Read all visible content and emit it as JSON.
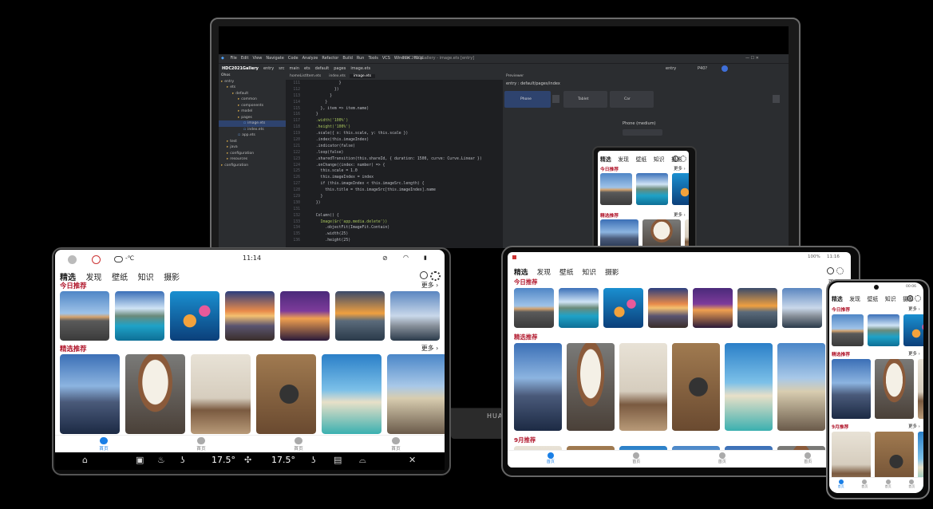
{
  "laptop": {
    "brand": "HUAWEI",
    "ide": {
      "menu": [
        "File",
        "Edit",
        "View",
        "Navigate",
        "Code",
        "Analyze",
        "Refactor",
        "Build",
        "Run",
        "Tools",
        "VCS",
        "Window",
        "Help"
      ],
      "window_title": "HDC2021Gallery - image.ets [entry]",
      "breadcrumb": [
        "HDC2021Gallery",
        "entry",
        "src",
        "main",
        "ets",
        "default",
        "pages",
        "image.ets"
      ],
      "run_config": "entry",
      "device": "P40?",
      "project_label": "Ohos",
      "tree": [
        {
          "label": "entry",
          "indent": 0
        },
        {
          "label": "ets",
          "indent": 1
        },
        {
          "label": "default",
          "indent": 2
        },
        {
          "label": "common",
          "indent": 3
        },
        {
          "label": "components",
          "indent": 3
        },
        {
          "label": "model",
          "indent": 3
        },
        {
          "label": "pages",
          "indent": 3
        },
        {
          "label": "image.ets",
          "indent": 4,
          "selected": true
        },
        {
          "label": "index.ets",
          "indent": 4
        },
        {
          "label": "app.ets",
          "indent": 3
        },
        {
          "label": "test",
          "indent": 1
        },
        {
          "label": "java",
          "indent": 1
        },
        {
          "label": "configuration",
          "indent": 1
        },
        {
          "label": "resources",
          "indent": 1
        },
        {
          "label": "configuration",
          "indent": 0
        }
      ],
      "tabs": [
        "homeListItem.ets",
        "index.ets",
        "image.ets"
      ],
      "active_tab": 2,
      "code": [
        {
          "n": "111",
          "t": "            }"
        },
        {
          "n": "112",
          "t": "          })"
        },
        {
          "n": "113",
          "t": "        }"
        },
        {
          "n": "114",
          "t": "      }"
        },
        {
          "n": "115",
          "t": "    }, item => item.name)"
        },
        {
          "n": "116",
          "t": "  }"
        },
        {
          "n": "117",
          "t": "  .width('100%')"
        },
        {
          "n": "118",
          "t": "  .height('100%')"
        },
        {
          "n": "119",
          "t": "  .scale({ x: this.scale, y: this.scale })"
        },
        {
          "n": "120",
          "t": "  .index(this.imageIndex)"
        },
        {
          "n": "121",
          "t": "  .indicator(false)"
        },
        {
          "n": "122",
          "t": "  .loop(false)"
        },
        {
          "n": "123",
          "t": "  .sharedTransition(this.shareId, { duration: 1500, curve: Curve.Linear })"
        },
        {
          "n": "124",
          "t": "  .onChange((index: number) => {"
        },
        {
          "n": "125",
          "t": "    this.scale = 1.0"
        },
        {
          "n": "126",
          "t": "    this.imageIndex = index"
        },
        {
          "n": "127",
          "t": "    if (this.imageIndex < this.imageSrc.length) {"
        },
        {
          "n": "128",
          "t": "      this.title = this.imageSrc[this.imageIndex].name"
        },
        {
          "n": "129",
          "t": "    }"
        },
        {
          "n": "130",
          "t": "  })"
        },
        {
          "n": "131",
          "t": ""
        },
        {
          "n": "132",
          "t": "  Column() {"
        },
        {
          "n": "133",
          "t": "    Image($r('app.media.delete'))"
        },
        {
          "n": "134",
          "t": "      .objectFit(ImageFit.Contain)"
        },
        {
          "n": "135",
          "t": "      .width(25)"
        },
        {
          "n": "136",
          "t": "      .height(25)"
        }
      ],
      "previewer_title": "Previewer",
      "previewer_path": "entry : default/pages/index",
      "devices": [
        "Phone",
        "Tablet",
        "Car"
      ],
      "phone_label": "Phone (medium)"
    }
  },
  "app": {
    "tabs": [
      "精选",
      "发现",
      "壁纸",
      "知识",
      "摄影"
    ],
    "section_today": "今日推荐",
    "section_featured": "精选推荐",
    "section_september": "9月推荐",
    "more": "更多",
    "nav_labels": [
      "首页",
      "首页",
      "首页",
      "首页"
    ],
    "colors": {
      "section": "#b0152a",
      "accent": "#1a7fe6"
    }
  },
  "car_tablet": {
    "status": {
      "temp": "-℃",
      "time": "11:14"
    },
    "dock": {
      "left_temp": "17.5°",
      "right_temp": "17.5°"
    }
  },
  "tablet": {
    "status": {
      "battery": "100%",
      "time": "11:16"
    }
  },
  "phone": {
    "status": {
      "time": "00:06"
    }
  }
}
